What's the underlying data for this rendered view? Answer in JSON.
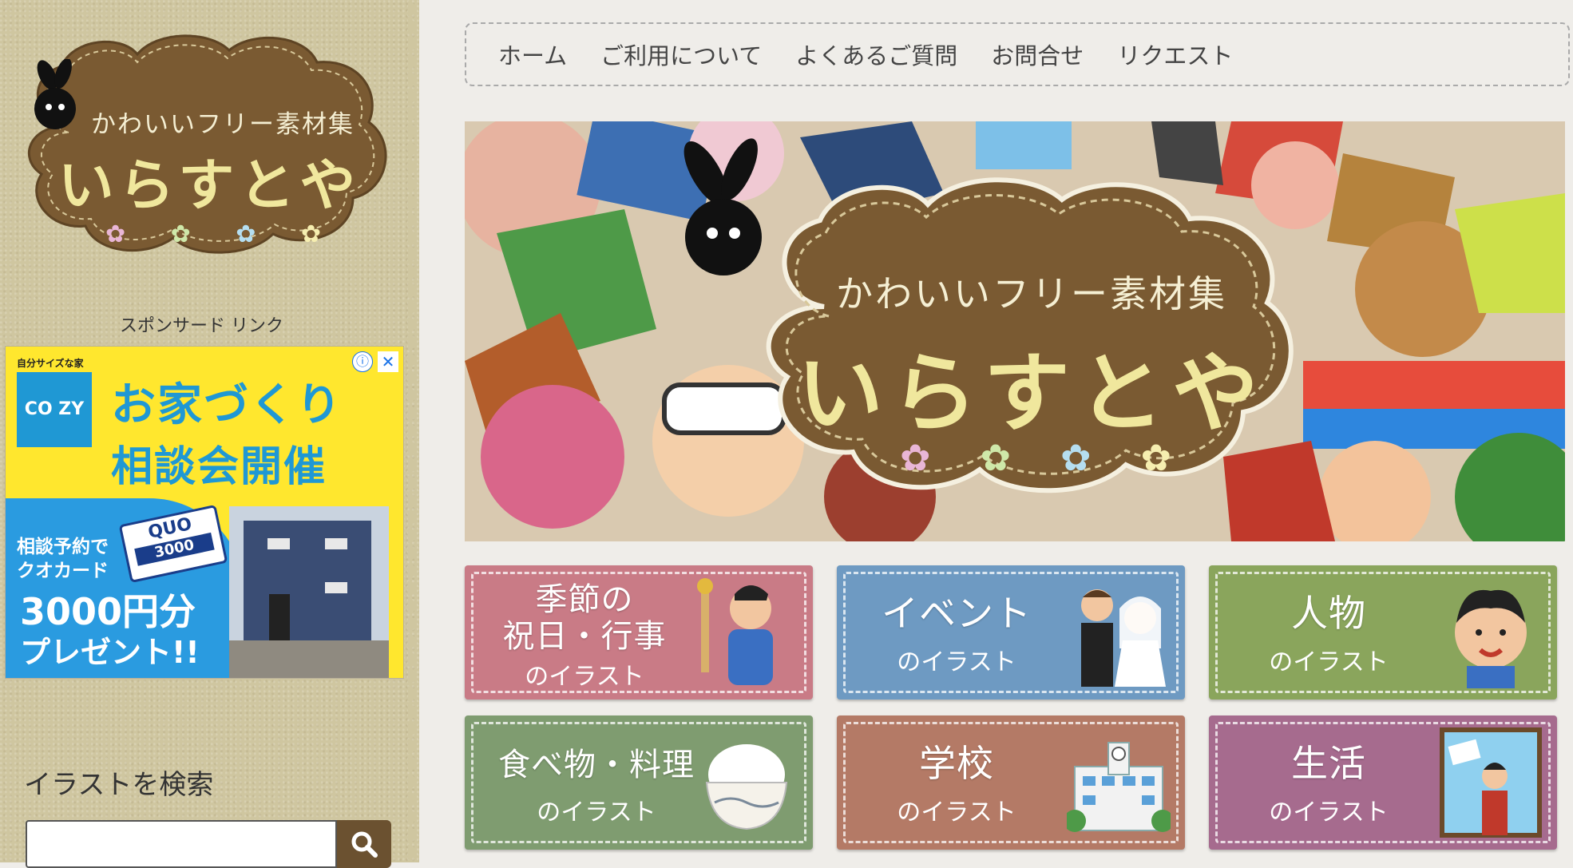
{
  "sidebar": {
    "logo": {
      "subtitle": "かわいいフリー素材集",
      "title": "いらすとや",
      "flowers": [
        "✿",
        "✿",
        "✿",
        "✿"
      ]
    },
    "sponsor_label": "スポンサード リンク",
    "ad": {
      "topline": "自分サイズな家",
      "brand": "CO ZY",
      "headline1": "お家づくり",
      "headline2": "相談会開催",
      "offer_line1": "相談予約で",
      "offer_line2": "クオカード",
      "offer_amount": "3000円分",
      "offer_present": "プレゼント!!",
      "card_brand": "QUO",
      "card_value": "3000",
      "info_icon": "ⓘ",
      "close_icon": "✕"
    },
    "search": {
      "title": "イラストを検索",
      "placeholder": "",
      "button_icon": "search-icon"
    }
  },
  "nav": {
    "items": [
      "ホーム",
      "ご利用について",
      "よくあるご質問",
      "お問合せ",
      "リクエスト"
    ]
  },
  "hero": {
    "subtitle": "かわいいフリー素材集",
    "title": "いらすとや",
    "flowers": [
      "✿",
      "✿",
      "✿",
      "✿"
    ]
  },
  "categories": [
    {
      "title": "季節の\n祝日・行事",
      "sub": "のイラスト",
      "color": "#c97b86"
    },
    {
      "title": "イベント",
      "sub": "のイラスト",
      "color": "#6e9ac2"
    },
    {
      "title": "人物",
      "sub": "のイラスト",
      "color": "#8aa55c"
    },
    {
      "title": "食べ物・料理",
      "sub": "のイラスト",
      "color": "#7f9c70"
    },
    {
      "title": "学校",
      "sub": "のイラスト",
      "color": "#b47a66"
    },
    {
      "title": "生活",
      "sub": "のイラスト",
      "color": "#a66b8e"
    }
  ],
  "colors": {
    "sidebar_bg": "#cfc6a0",
    "logo_brown": "#7a5a32",
    "logo_title": "#f0e79d",
    "search_button": "#6b5130"
  }
}
